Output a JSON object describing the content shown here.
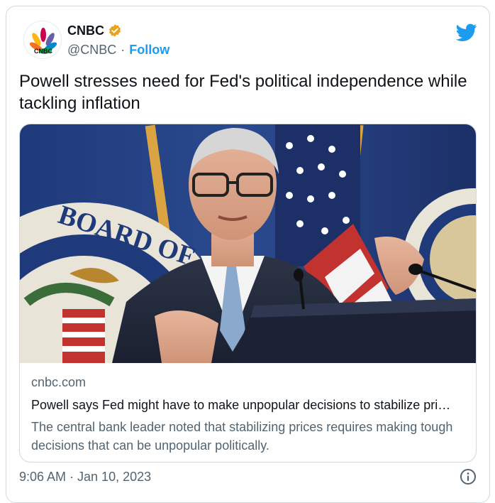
{
  "account": {
    "display_name": "CNBC",
    "handle": "@CNBC",
    "separator": "·",
    "follow_label": "Follow",
    "avatar_text": "CNBC"
  },
  "tweet": {
    "text": "Powell stresses need for Fed's political independence while tackling inflation"
  },
  "card": {
    "domain": "cnbc.com",
    "title": "Powell says Fed might have to make unpopular decisions to stabilize pri…",
    "description": "The central bank leader noted that stabilizing prices requires making tough decisions that can be unpopular politically.",
    "seal_text": "BOARD OF"
  },
  "footer": {
    "timestamp": "9:06 AM · Jan 10, 2023"
  },
  "icons": [
    "verified-badge-icon",
    "twitter-bird-icon",
    "info-icon"
  ],
  "colors": {
    "accent": "#1d9bf0",
    "verified": "#e8a317",
    "secondary_text": "#536471",
    "border": "#cfd9de"
  }
}
